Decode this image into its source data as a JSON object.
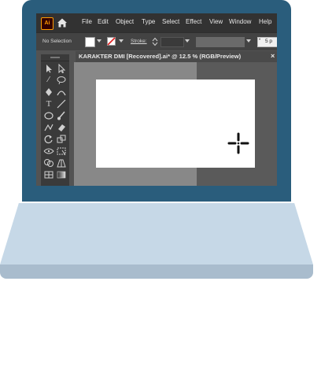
{
  "app": {
    "logo_text": "Ai",
    "menu": [
      "File",
      "Edit",
      "Object",
      "Type",
      "Select",
      "Effect",
      "View",
      "Window",
      "Help"
    ]
  },
  "control_bar": {
    "selection_status": "No Selection",
    "stroke_label": "Stroke:",
    "brush_label": "5 p"
  },
  "document": {
    "tab_title": "KARAKTER DMI [Recovered].ai* @ 12.5 % (RGB/Preview)",
    "close_glyph": "×"
  },
  "colors": {
    "laptop_lid": "#2a5d7c",
    "laptop_base": "#c6d8e7",
    "ui_dark": "#323232",
    "artboard": "#ffffff"
  },
  "icons": [
    "home-icon",
    "selection-tool-icon",
    "direct-selection-icon",
    "magic-wand-icon",
    "lasso-icon",
    "pen-icon",
    "curvature-icon",
    "type-icon",
    "line-icon",
    "ellipse-icon",
    "paintbrush-icon",
    "shaper-icon",
    "eraser-icon",
    "rotate-icon",
    "scale-icon",
    "width-icon",
    "free-transform-icon",
    "shape-builder-icon",
    "perspective-icon",
    "mesh-icon",
    "gradient-icon",
    "crosshair-cursor-icon"
  ]
}
